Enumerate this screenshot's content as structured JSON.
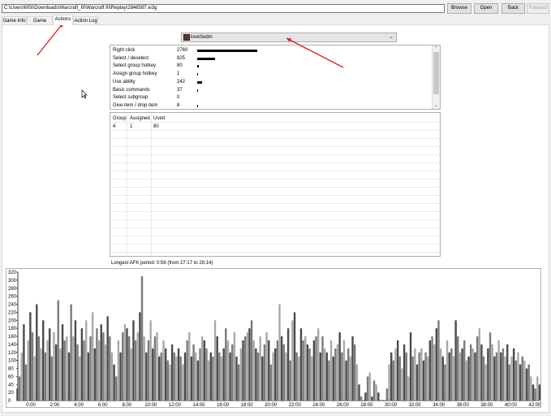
{
  "toolbar": {
    "path": "C:\\Users\\MSI\\Downloads\\Warcraft_III\\Warcraft III\\Replay\\2846587.w3g",
    "browse": "Browse",
    "open": "Open",
    "back": "Back",
    "forward": "Forward"
  },
  "tabs": [
    {
      "label": "Game Info"
    },
    {
      "label": "Game Chat"
    },
    {
      "label": "Actions"
    },
    {
      "label": "Action Log"
    }
  ],
  "player": {
    "name": "loveSedm"
  },
  "actions": [
    {
      "name": "Right click",
      "count": "2760",
      "value": 2760
    },
    {
      "name": "Select / deselect",
      "count": "825",
      "value": 825
    },
    {
      "name": "Select group hotkey",
      "count": "80",
      "value": 80
    },
    {
      "name": "Assign group hotkey",
      "count": "1",
      "value": 1
    },
    {
      "name": "Use ability",
      "count": "242",
      "value": 242
    },
    {
      "name": "Basic commands",
      "count": "37",
      "value": 37
    },
    {
      "name": "Select subgroup",
      "count": "0",
      "value": 0
    },
    {
      "name": "Give item / drop item",
      "count": "8",
      "value": 8
    }
  ],
  "groups": {
    "headers": [
      "Group",
      "Assigned",
      "Used"
    ],
    "rows": [
      [
        "4",
        "1",
        "80"
      ]
    ]
  },
  "afk": "Longest AFK period: 0:56 (from 27:17 to 28:14)",
  "colors": {
    "bar_dark": "#4a4a4a",
    "bar_mid": "#7a7a7a",
    "bar_light": "#a8a8a8",
    "arrow": "#e02020"
  },
  "chart_data": {
    "type": "bar",
    "title": "",
    "xlabel": "",
    "ylabel": "",
    "ylim": [
      0,
      320
    ],
    "yticks": [
      0,
      20,
      40,
      60,
      80,
      100,
      120,
      140,
      160,
      180,
      200,
      220,
      240,
      260,
      280,
      300,
      320
    ],
    "xticks": [
      "0:00",
      "2:00",
      "4:00",
      "6:00",
      "8:00",
      "10:00",
      "12:00",
      "14:00",
      "16:00",
      "18:00",
      "20:00",
      "22:00",
      "24:00",
      "26:00",
      "28:00",
      "30:00",
      "32:00",
      "34:00",
      "36:00",
      "38:00",
      "40:00",
      "42:00"
    ],
    "x_minutes_range": [
      0,
      42.5
    ],
    "series": [
      {
        "values": [
          30,
          60,
          120,
          190,
          90,
          150,
          220,
          170,
          110,
          240,
          160,
          130,
          200,
          120,
          150,
          180,
          110,
          170,
          140,
          250,
          130,
          190,
          150,
          160,
          120,
          240,
          160,
          200,
          140,
          110,
          180,
          150,
          200,
          120,
          160,
          220,
          130,
          180,
          150,
          190,
          170,
          140,
          210,
          160,
          120,
          90,
          60,
          150,
          120,
          170,
          190,
          180,
          160,
          130,
          200,
          150,
          170,
          220,
          310,
          160,
          120,
          150,
          200,
          130,
          160,
          170,
          110,
          120,
          150,
          130,
          100,
          90,
          140,
          120,
          110,
          130,
          110,
          90,
          120,
          150,
          170,
          110,
          140,
          120,
          100,
          130,
          160,
          150,
          130,
          100,
          120,
          110,
          200,
          160,
          120,
          110,
          130,
          180,
          150,
          120,
          140,
          170,
          110,
          90,
          130,
          150,
          160,
          170,
          180,
          200,
          150,
          130,
          120,
          160,
          110,
          140,
          170,
          150,
          90,
          120,
          130,
          150,
          240,
          160,
          140,
          120,
          180,
          100,
          200,
          220,
          120,
          110,
          180,
          150,
          160,
          140,
          130,
          110,
          150,
          160,
          180,
          120,
          160,
          130,
          120,
          100,
          150,
          110,
          130,
          140,
          170,
          120,
          150,
          100,
          130,
          110,
          160,
          140,
          90,
          40,
          10,
          0,
          20,
          60,
          70,
          10,
          50,
          40,
          20,
          0,
          0,
          0,
          30,
          90,
          120,
          100,
          130,
          150,
          110,
          80,
          140,
          120,
          60,
          170,
          110,
          130,
          90,
          120,
          130,
          100,
          120,
          110,
          150,
          160,
          140,
          180,
          200,
          130,
          110,
          90,
          150,
          120,
          130,
          110,
          200,
          160,
          120,
          130,
          150,
          100,
          110,
          140,
          130,
          120,
          160,
          180,
          140,
          110,
          90,
          130,
          170,
          140,
          110,
          120,
          150,
          120,
          130,
          110,
          140,
          90,
          110,
          130,
          100,
          120,
          90,
          110,
          100,
          80,
          90,
          60,
          40,
          30,
          60,
          40
        ]
      }
    ]
  }
}
